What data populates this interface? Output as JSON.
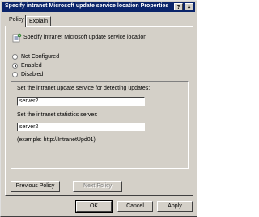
{
  "window": {
    "title": "Specify intranet Microsoft update service location Properties",
    "help_glyph": "?",
    "close_glyph": "×"
  },
  "tabs": [
    {
      "label": "Policy",
      "active": true
    },
    {
      "label": "Explain",
      "active": false
    }
  ],
  "policy": {
    "name": "Specify intranet Microsoft update service location",
    "icon": "policy-setting-icon"
  },
  "options": [
    {
      "label": "Not Configured",
      "checked": false
    },
    {
      "label": "Enabled",
      "checked": true
    },
    {
      "label": "Disabled",
      "checked": false
    }
  ],
  "settings": {
    "update_service_label": "Set the intranet update service for detecting updates:",
    "update_service_value": "server2",
    "stats_server_label": "Set the intranet statistics server:",
    "stats_server_value": "server2",
    "example_text": "(example: http://IntranetUpd01)"
  },
  "nav": {
    "previous_label": "Previous Policy",
    "next_label": "Next Policy"
  },
  "footer": {
    "ok_label": "OK",
    "cancel_label": "Cancel",
    "apply_label": "Apply"
  }
}
